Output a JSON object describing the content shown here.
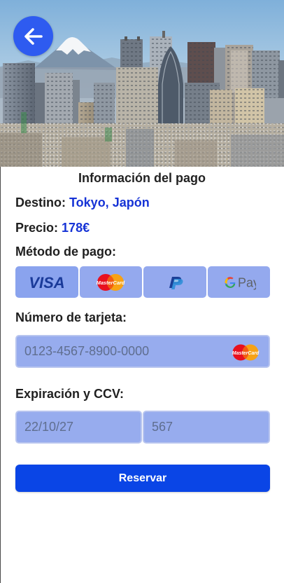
{
  "header": {
    "title": "Información del pago"
  },
  "trip": {
    "destination_label": "Destino:",
    "destination_value": "Tokyo, Japón",
    "price_label": "Precio:",
    "price_value": "178€"
  },
  "payment": {
    "section_label": "Método de pago:",
    "methods": [
      {
        "name": "VISA",
        "icon": "visa-logo"
      },
      {
        "name": "MasterCard",
        "icon": "mastercard-logo"
      },
      {
        "name": "PayPal",
        "icon": "paypal-logo"
      },
      {
        "name": "Pay",
        "icon": "google-pay-logo"
      }
    ]
  },
  "card": {
    "number_label": "Número de tarjeta:",
    "number_placeholder": "0123-4567-8900-0000",
    "brand_icon": "mastercard-icon"
  },
  "expiry": {
    "label": "Expiración y CCV:",
    "date_placeholder": "22/10/27",
    "ccv_placeholder": "567"
  },
  "actions": {
    "reserve_label": "Reservar"
  },
  "colors": {
    "accent": "#0a45e6",
    "value_text": "#1633d6",
    "field_bg": "#97acee",
    "back_button": "#2e5bf0"
  }
}
